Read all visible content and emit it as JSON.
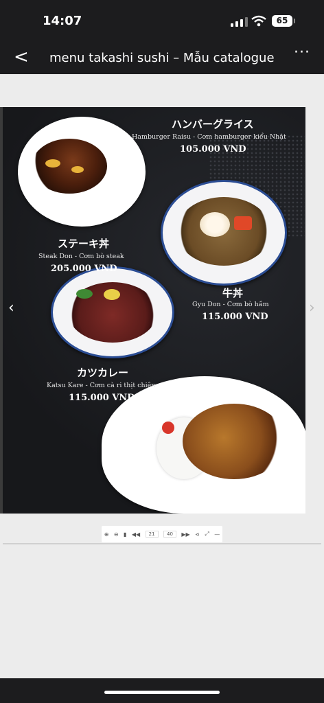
{
  "status_bar": {
    "time": "14:07",
    "battery": "65"
  },
  "nav": {
    "back_label": "<",
    "title": "menu takashi sushi – Mẫu catalogue",
    "more_label": "···"
  },
  "menu": {
    "items": [
      {
        "jp": "ハンバーグライス",
        "name": "Hamburger Raisu - Cơm hamburger kiểu Nhật",
        "price": "105.000 VND"
      },
      {
        "jp": "ステーキ丼",
        "name": "Steak Don - Cơm bò steak",
        "price": "205.000 VND"
      },
      {
        "jp": "牛丼",
        "name": "Gyu Don - Cơm bò hầm",
        "price": "115.000 VND"
      },
      {
        "jp": "カツカレー",
        "name": "Katsu Kare - Cơm cà ri thịt chiên",
        "price": "115.000 VND"
      }
    ]
  },
  "viewer": {
    "prev_label": "‹",
    "next_label": "›"
  },
  "toolbar": {
    "current_page": "21",
    "total_pages": "40"
  },
  "colors": {
    "page_bg": "#17181b",
    "bowl_rim": "#2b4d94",
    "text": "#ffffff"
  }
}
